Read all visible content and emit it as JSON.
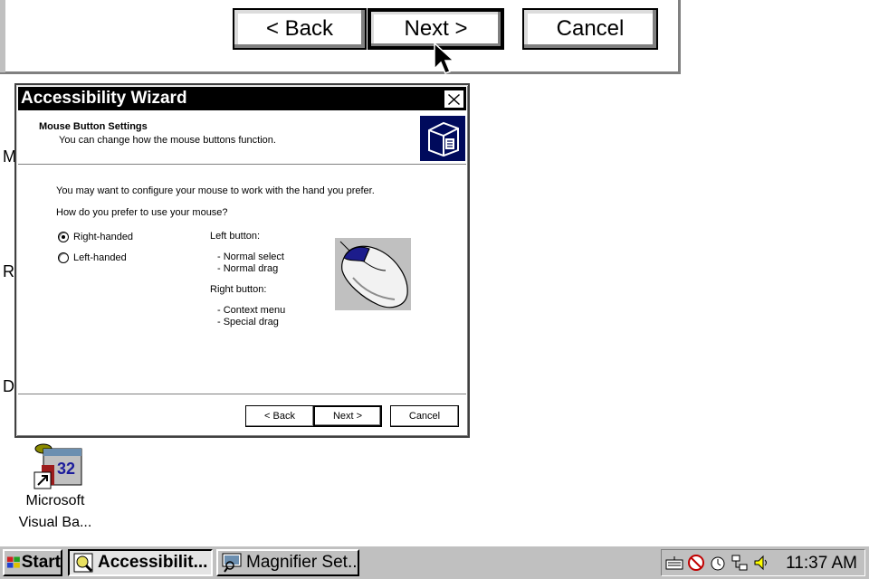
{
  "magnifier": {
    "back_label": "< Back",
    "next_label": "Next >",
    "cancel_label": "Cancel"
  },
  "desktop": {
    "clipped_labels": [
      "M",
      "R",
      "D"
    ],
    "icon": {
      "name": "vb-icon",
      "label_line1": "Microsoft",
      "label_line2": "Visual Ba..."
    }
  },
  "dialog": {
    "title": "Accessibility Wizard",
    "header_title": "Mouse Button Settings",
    "header_subtitle": "You can change how the mouse buttons function.",
    "intro": "You may want to configure your mouse to work with the hand you prefer.",
    "question": "How do you prefer to use your mouse?",
    "options": [
      {
        "label": "Right-handed",
        "selected": true
      },
      {
        "label": "Left-handed",
        "selected": false
      }
    ],
    "left_button_title": "Left button:",
    "left_button_items": [
      "-  Normal select",
      "-  Normal drag"
    ],
    "right_button_title": "Right button:",
    "right_button_items": [
      "-  Context menu",
      "-  Special drag"
    ],
    "back_label": "< Back",
    "next_label": "Next >",
    "cancel_label": "Cancel",
    "accent_color": "#000a5c",
    "mouse_highlight_color": "#1c1c8c"
  },
  "taskbar": {
    "start_label": "Start",
    "tasks": [
      {
        "label": "Accessibilit...",
        "active": true
      },
      {
        "label": "Magnifier Set...",
        "active": false
      }
    ],
    "tray_icons": [
      "keyboard-icon",
      "stickykeys-icon",
      "timer-icon",
      "network-icon",
      "volume-icon"
    ],
    "clock": "11:37 AM"
  }
}
